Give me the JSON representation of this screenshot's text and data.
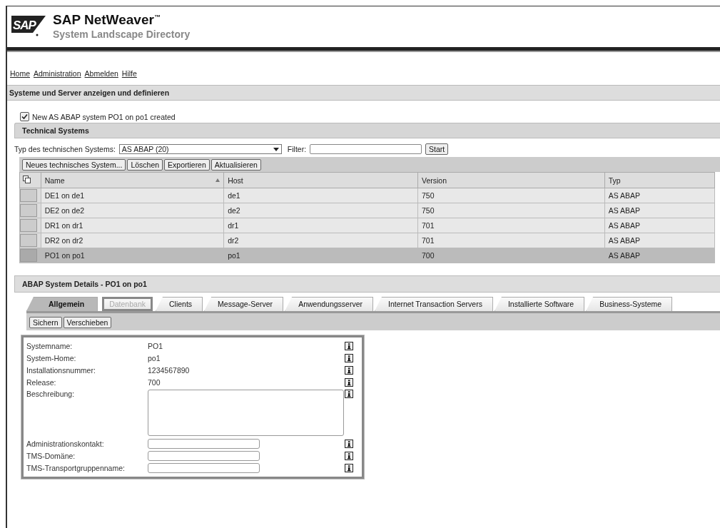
{
  "header": {
    "logo": "SAP",
    "title": "SAP NetWeaver",
    "trademark": "™",
    "subtitle": "System Landscape Directory"
  },
  "nav": [
    "Home",
    "Administration",
    "Abmelden",
    "Hilfe"
  ],
  "page_title": "Systeme und Server anzeigen und definieren",
  "message": {
    "text": "New AS ABAP system PO1 on po1 created",
    "checked": true
  },
  "technical_systems": {
    "title": "Technical Systems",
    "type_label": "Typ des technischen Systems:",
    "type_value": "AS ABAP (20)",
    "filter_label": "Filter:",
    "start_button": "Start",
    "buttons": [
      "Neues technisches System...",
      "Löschen",
      "Exportieren",
      "Aktualisieren"
    ],
    "table": {
      "columns": [
        "Name",
        "Host",
        "Version",
        "Typ"
      ],
      "rows": [
        {
          "cells": [
            "DE1 on de1",
            "de1",
            "750",
            "AS ABAP"
          ],
          "selected": false
        },
        {
          "cells": [
            "DE2 on de2",
            "de2",
            "750",
            "AS ABAP"
          ],
          "selected": false
        },
        {
          "cells": [
            "DR1 on dr1",
            "dr1",
            "701",
            "AS ABAP"
          ],
          "selected": false
        },
        {
          "cells": [
            "DR2 on dr2",
            "dr2",
            "701",
            "AS ABAP"
          ],
          "selected": false
        },
        {
          "cells": [
            "PO1 on po1",
            "po1",
            "700",
            "AS ABAP"
          ],
          "selected": true
        }
      ]
    }
  },
  "details": {
    "title": "ABAP System Details - PO1 on po1",
    "tabs": [
      {
        "label": "Allgemein",
        "selected": true,
        "disabled": false
      },
      {
        "label": "Datenbank",
        "selected": false,
        "disabled": true
      },
      {
        "label": "Clients",
        "selected": false,
        "disabled": false
      },
      {
        "label": "Message-Server",
        "selected": false,
        "disabled": false
      },
      {
        "label": "Anwendungsserver",
        "selected": false,
        "disabled": false
      },
      {
        "label": "Internet Transaction Servers",
        "selected": false,
        "disabled": false
      },
      {
        "label": "Installierte Software",
        "selected": false,
        "disabled": false
      },
      {
        "label": "Business-Systeme",
        "selected": false,
        "disabled": false
      }
    ],
    "buttons": [
      "Sichern",
      "Verschieben"
    ],
    "fields": [
      {
        "label": "Systemname:",
        "kind": "text",
        "value": "PO1"
      },
      {
        "label": "System-Home:",
        "kind": "text",
        "value": "po1"
      },
      {
        "label": "Installationsnummer:",
        "kind": "text",
        "value": "1234567890"
      },
      {
        "label": "Release:",
        "kind": "text",
        "value": "700"
      },
      {
        "label": "Beschreibung:",
        "kind": "textarea"
      },
      {
        "label": "Administrationskontakt:",
        "kind": "input"
      },
      {
        "label": "TMS-Domäne:",
        "kind": "input"
      },
      {
        "label": "TMS-Transportgruppenname:",
        "kind": "input"
      }
    ]
  }
}
